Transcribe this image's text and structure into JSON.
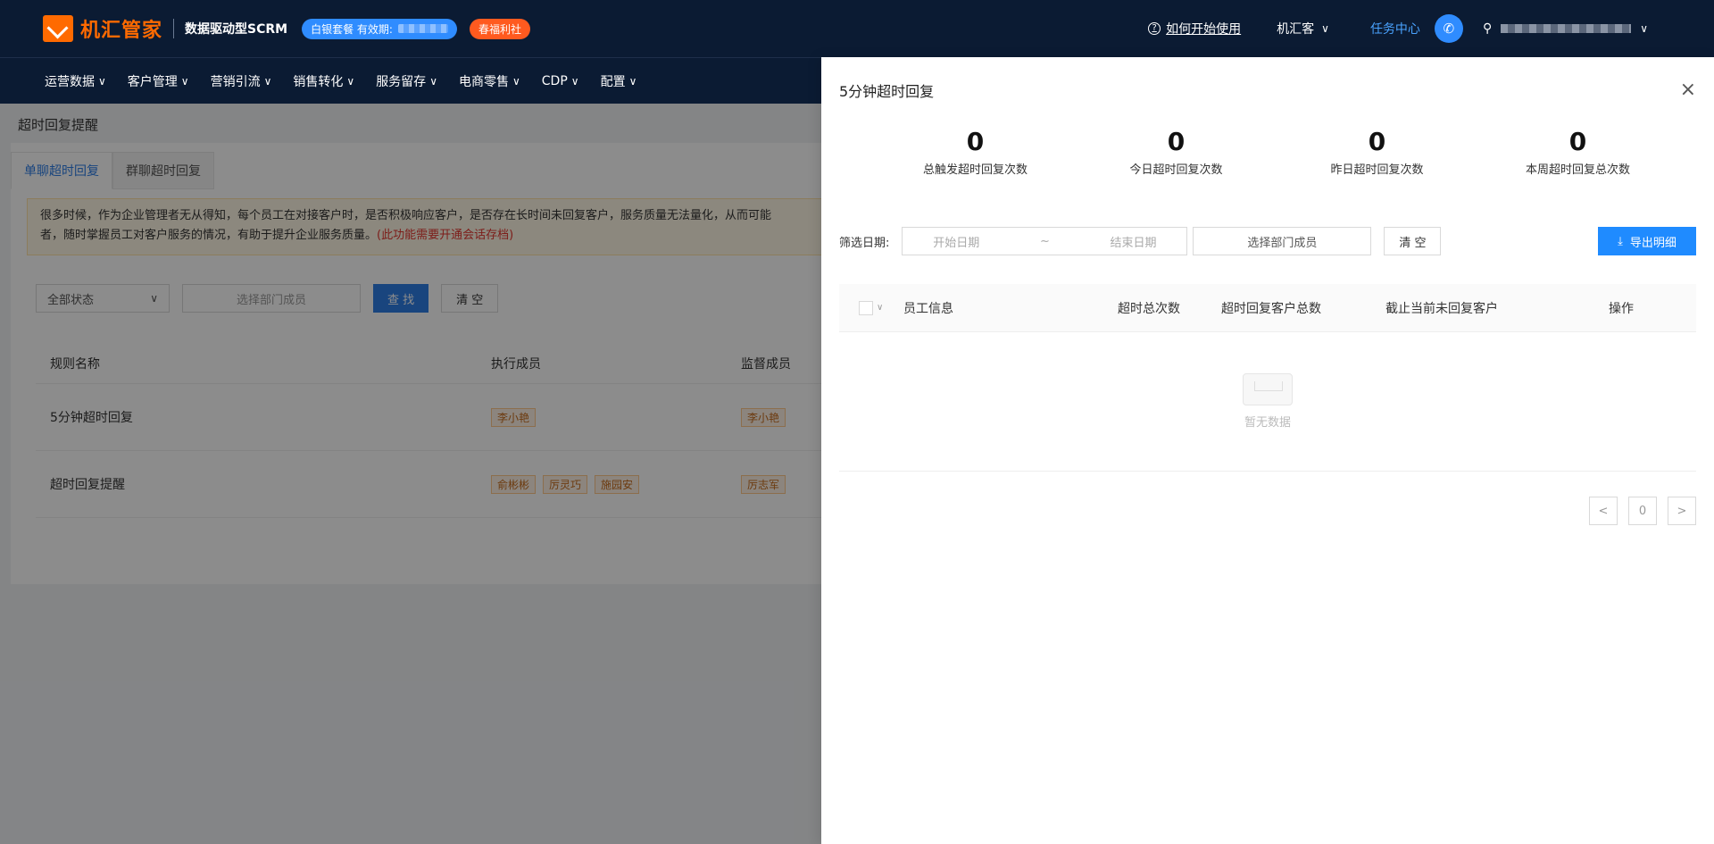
{
  "header": {
    "logo_text": "机汇管家",
    "subtitle": "数据驱动型SCRM",
    "plan_label": "白银套餐 有效期:",
    "welfare_label": "春福利社",
    "help_text": "如何开始使用",
    "org_name": "机汇客",
    "task_center": "任务中心"
  },
  "nav": {
    "items": [
      {
        "label": "运营数据"
      },
      {
        "label": "客户管理"
      },
      {
        "label": "营销引流"
      },
      {
        "label": "销售转化"
      },
      {
        "label": "服务留存"
      },
      {
        "label": "电商零售"
      },
      {
        "label": "CDP"
      },
      {
        "label": "配置"
      }
    ]
  },
  "page": {
    "title": "超时回复提醒",
    "tabs": [
      {
        "label": "单聊超时回复"
      },
      {
        "label": "群聊超时回复"
      }
    ],
    "notice_text": "很多时候，作为企业管理者无从得知，每个员工在对接客户时，是否积极响应客户，是否存在长时间未回复客户，服务质量无法量化，从而可能",
    "notice_text2": "者，随时掌握员工对客户服务的情况，有助于提升企业服务质量。",
    "notice_red": "(此功能需要开通会话存档)",
    "status_select": "全部状态",
    "dept_placeholder": "选择部门成员",
    "search_btn": "查 找",
    "clear_btn": "清 空",
    "table": {
      "headers": [
        "规则名称",
        "执行成员",
        "监督成员"
      ],
      "rows": [
        {
          "name": "5分钟超时回复",
          "executors": [
            "李小艳"
          ],
          "supervisors": [
            "李小艳"
          ]
        },
        {
          "name": "超时回复提醒",
          "executors": [
            "俞彬彬",
            "厉灵巧",
            "施园安"
          ],
          "supervisors": [
            "厉志军"
          ]
        }
      ]
    }
  },
  "drawer": {
    "title": "5分钟超时回复",
    "close": "×",
    "stats": [
      {
        "value": "0",
        "label": "总触发超时回复次数"
      },
      {
        "value": "0",
        "label": "今日超时回复次数"
      },
      {
        "value": "0",
        "label": "昨日超时回复次数"
      },
      {
        "value": "0",
        "label": "本周超时回复总次数"
      }
    ],
    "filter_label": "筛选日期:",
    "start_placeholder": "开始日期",
    "range_sep": "~",
    "end_placeholder": "结束日期",
    "dept_placeholder": "选择部门成员",
    "clear_btn": "清 空",
    "export_btn": "导出明细",
    "table_headers": [
      "员工信息",
      "超时总次数",
      "超时回复客户总数",
      "截止当前未回复客户",
      "操作"
    ],
    "empty_text": "暂无数据",
    "pager": {
      "prev": "<",
      "page": "0",
      "next": ">"
    }
  },
  "colors": {
    "header_bg": "#0b1b33",
    "brand_orange": "#ff6a00",
    "primary_blue": "#2f7ee6",
    "export_blue": "#1f8bff"
  }
}
